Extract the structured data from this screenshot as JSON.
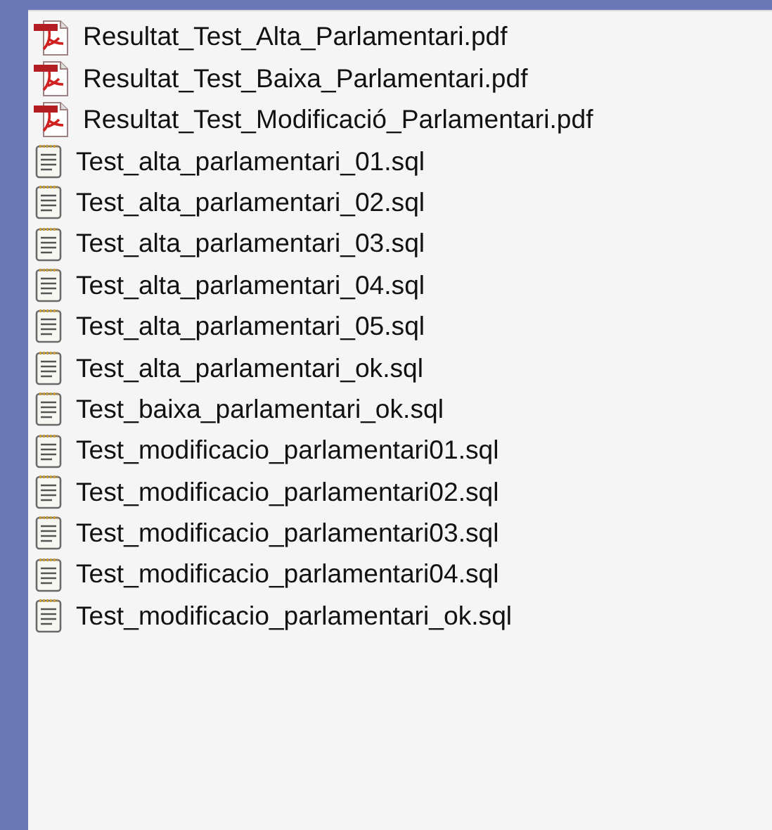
{
  "files": [
    {
      "name": "Resultat_Test_Alta_Parlamentari.pdf",
      "kind": "pdf"
    },
    {
      "name": "Resultat_Test_Baixa_Parlamentari.pdf",
      "kind": "pdf"
    },
    {
      "name": "Resultat_Test_Modificació_Parlamentari.pdf",
      "kind": "pdf"
    },
    {
      "name": "Test_alta_parlamentari_01.sql",
      "kind": "text"
    },
    {
      "name": "Test_alta_parlamentari_02.sql",
      "kind": "text"
    },
    {
      "name": "Test_alta_parlamentari_03.sql",
      "kind": "text"
    },
    {
      "name": "Test_alta_parlamentari_04.sql",
      "kind": "text"
    },
    {
      "name": "Test_alta_parlamentari_05.sql",
      "kind": "text"
    },
    {
      "name": "Test_alta_parlamentari_ok.sql",
      "kind": "text"
    },
    {
      "name": "Test_baixa_parlamentari_ok.sql",
      "kind": "text"
    },
    {
      "name": "Test_modificacio_parlamentari01.sql",
      "kind": "text"
    },
    {
      "name": "Test_modificacio_parlamentari02.sql",
      "kind": "text"
    },
    {
      "name": "Test_modificacio_parlamentari03.sql",
      "kind": "text"
    },
    {
      "name": "Test_modificacio_parlamentari04.sql",
      "kind": "text"
    },
    {
      "name": "Test_modificacio_parlamentari_ok.sql",
      "kind": "text"
    }
  ]
}
